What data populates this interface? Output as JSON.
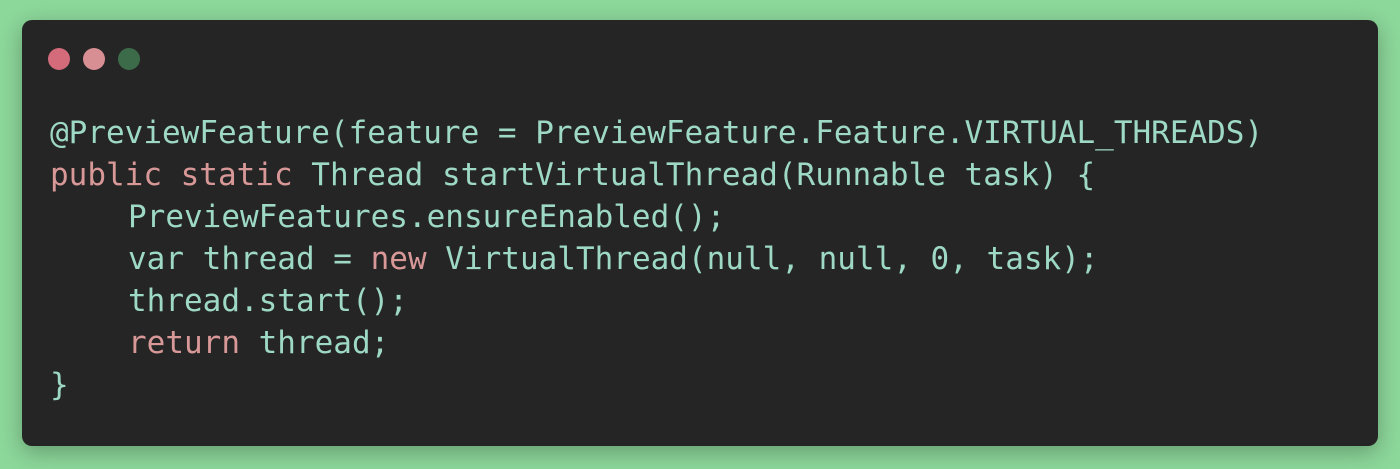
{
  "window": {
    "controls": [
      {
        "name": "close",
        "color": "#d46b7a"
      },
      {
        "name": "minimize",
        "color": "#d88f93"
      },
      {
        "name": "maximize",
        "color": "#3b6b49"
      }
    ]
  },
  "code": {
    "lines": [
      {
        "indent": 0,
        "tokens": [
          {
            "text": "@PreviewFeature(feature = PreviewFeature.Feature.VIRTUAL_THREADS)",
            "kind": "plain"
          }
        ]
      },
      {
        "indent": 0,
        "tokens": [
          {
            "text": "public static",
            "kind": "kw"
          },
          {
            "text": " Thread startVirtualThread(Runnable task) {",
            "kind": "plain"
          }
        ]
      },
      {
        "indent": 1,
        "tokens": [
          {
            "text": "PreviewFeatures.ensureEnabled();",
            "kind": "plain"
          }
        ]
      },
      {
        "indent": 1,
        "tokens": [
          {
            "text": "var thread = ",
            "kind": "plain"
          },
          {
            "text": "new",
            "kind": "kw"
          },
          {
            "text": " VirtualThread(null, null, 0, task);",
            "kind": "plain"
          }
        ]
      },
      {
        "indent": 1,
        "tokens": [
          {
            "text": "thread.start();",
            "kind": "plain"
          }
        ]
      },
      {
        "indent": 1,
        "tokens": [
          {
            "text": "return",
            "kind": "kw"
          },
          {
            "text": " thread;",
            "kind": "plain"
          }
        ]
      },
      {
        "indent": 0,
        "tokens": [
          {
            "text": "}",
            "kind": "plain"
          }
        ]
      }
    ]
  }
}
